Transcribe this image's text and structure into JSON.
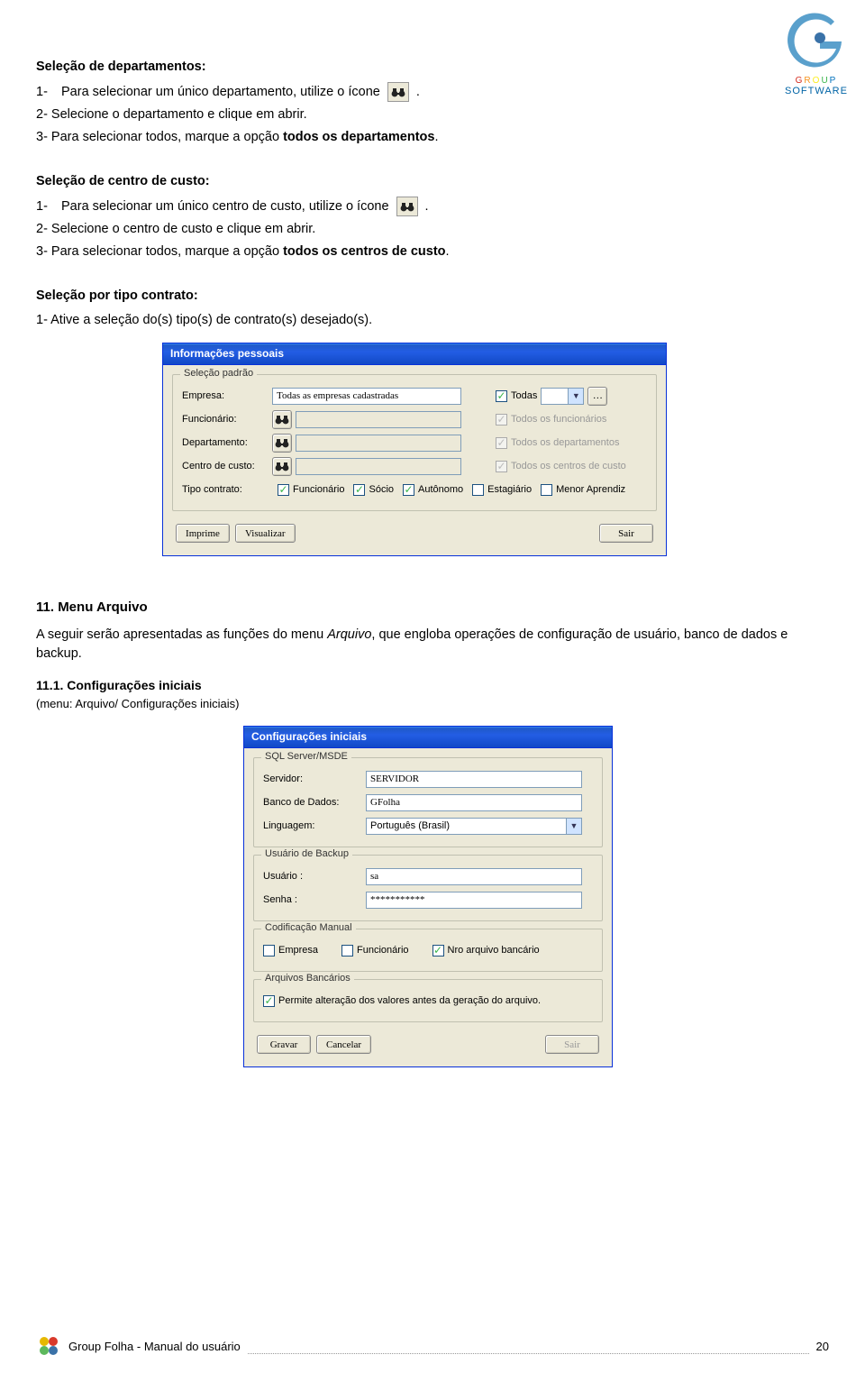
{
  "brand": {
    "group": "G R O U P",
    "software": "SOFTWARE"
  },
  "s1": {
    "title": "Seleção de departamentos:",
    "l1a": "1-",
    "l1b": "Para selecionar um único departamento, utilize o ícone ",
    "l1c": ".",
    "l2": "2-   Selecione o departamento e clique em abrir.",
    "l3a": "3-   Para selecionar todos, marque a opção ",
    "l3b": "todos os departamentos",
    "l3c": "."
  },
  "s2": {
    "title": "Seleção de centro de custo:",
    "l1a": "1-",
    "l1b": "Para selecionar um único centro de custo, utilize o ícone ",
    "l1c": ".",
    "l2": "2-   Selecione o centro de custo e clique em abrir.",
    "l3a": "3-   Para selecionar todos, marque a opção ",
    "l3b": "todos os centros de custo",
    "l3c": "."
  },
  "s3": {
    "title": "Seleção por tipo contrato:",
    "l1": "1-   Ative a seleção do(s) tipo(s) de contrato(s) desejado(s)."
  },
  "dlg1": {
    "title": "Informações pessoais",
    "group": "Seleção padrão",
    "empresa_lbl": "Empresa:",
    "empresa_val": "Todas as empresas cadastradas",
    "todas_lbl": "Todas",
    "funcionario_lbl": "Funcionário:",
    "todos_func": "Todos os funcionários",
    "departamento_lbl": "Departamento:",
    "todos_dep": "Todos os departamentos",
    "centro_lbl": "Centro de custo:",
    "todos_cc": "Todos os centros de custo",
    "tipo_lbl": "Tipo contrato:",
    "tc_func": "Funcionário",
    "tc_socio": "Sócio",
    "tc_auto": "Autônomo",
    "tc_estag": "Estagiário",
    "tc_menor": "Menor Aprendiz",
    "btn_imprime": "Imprime",
    "btn_vis": "Visualizar",
    "btn_sair": "Sair"
  },
  "sect11": {
    "title": "11. Menu Arquivo",
    "para_a": "A seguir serão apresentadas as funções do menu ",
    "para_b": "Arquivo",
    "para_c": ", que engloba operações de configuração de usuário, banco de dados e backup."
  },
  "sect111": {
    "title": "11.1. Configurações iniciais",
    "path": "(menu: Arquivo/ Configurações iniciais)"
  },
  "dlg2": {
    "title": "Configurações iniciais",
    "g1": "SQL Server/MSDE",
    "servidor_lbl": "Servidor:",
    "servidor_val": "SERVIDOR",
    "bd_lbl": "Banco de Dados:",
    "bd_val": "GFolha",
    "ling_lbl": "Linguagem:",
    "ling_val": "Português (Brasil)",
    "g2": "Usuário de Backup",
    "user_lbl": "Usuário :",
    "user_val": "sa",
    "senha_lbl": "Senha :",
    "senha_val": "***********",
    "g3": "Codificação Manual",
    "cm_emp": "Empresa",
    "cm_func": "Funcionário",
    "cm_nro": "Nro arquivo bancário",
    "g4": "Arquivos Bancários",
    "ab_perm": "Permite alteração dos valores  antes da geração do arquivo.",
    "btn_gravar": "Gravar",
    "btn_cancelar": "Cancelar",
    "btn_sair": "Sair"
  },
  "footer": {
    "text": "Group Folha - Manual do usuário",
    "page": "20"
  }
}
